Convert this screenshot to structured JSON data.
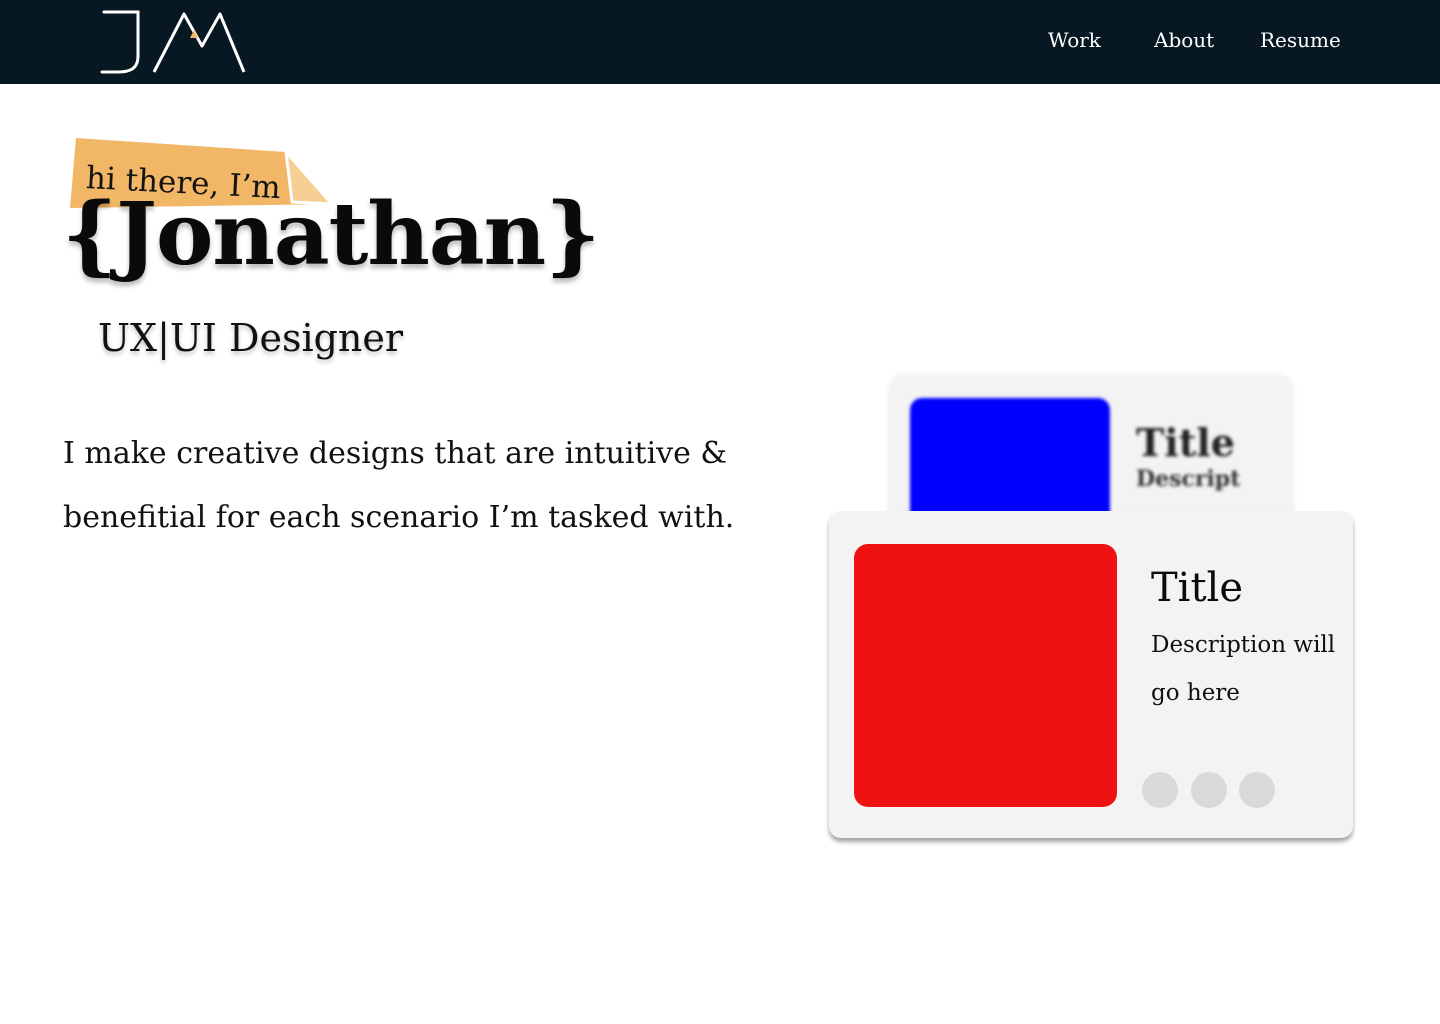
{
  "nav": {
    "logo_text": "JM",
    "links": [
      {
        "label": "Work"
      },
      {
        "label": "About"
      },
      {
        "label": "Resume"
      }
    ]
  },
  "hero": {
    "tag_text": "hi there, I’m",
    "name": "{Jonathan}",
    "role": "UX|UI Designer",
    "intro": "I make creative designs that are intuitive & benefitial for each scenario I’m tasked with."
  },
  "cards": {
    "back": {
      "title": "Title",
      "description": "Descript",
      "thumb_color": "#0000ff"
    },
    "front": {
      "title": "Title",
      "description": "Description will go here",
      "thumb_color": "#f01212"
    },
    "dots_count": 3
  },
  "colors": {
    "nav_bg": "#071822",
    "tag": "#f2b766",
    "card_bg": "#f3f3f3",
    "dot": "#d9d9d9"
  }
}
